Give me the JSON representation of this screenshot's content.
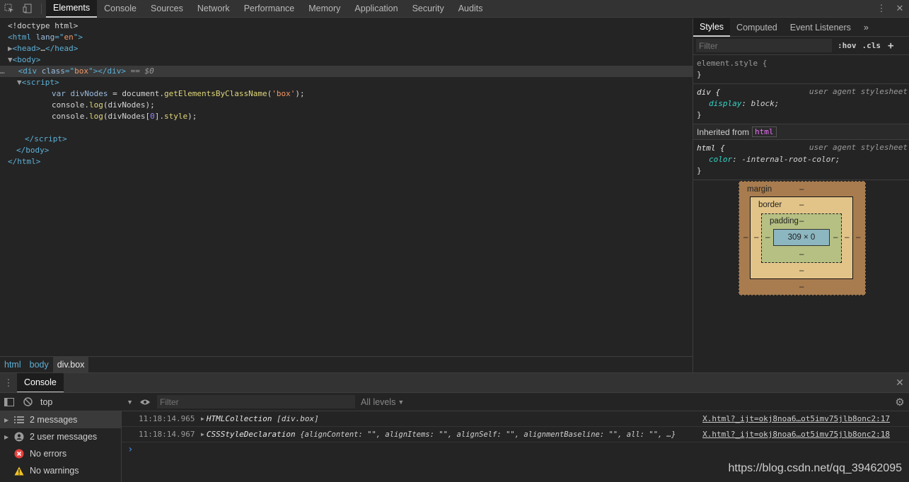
{
  "topbar": {
    "tabs": [
      "Elements",
      "Console",
      "Sources",
      "Network",
      "Performance",
      "Memory",
      "Application",
      "Security",
      "Audits"
    ],
    "active_tab": "Elements",
    "icons": [
      "inspect-icon",
      "device-toolbar-icon",
      "more-vert-icon",
      "close-icon"
    ]
  },
  "elements": {
    "doctype": "<!doctype html>",
    "html_lang": "en",
    "head_collapsed": "…",
    "box_class": "box",
    "eq_marker": "== $0",
    "script_lines": [
      "var divNodes = document.getElementsByClassName('box');",
      "console.log(divNodes);",
      "console.log(divNodes[0].style);"
    ]
  },
  "breadcrumb": [
    "html",
    "body",
    "div.box"
  ],
  "styles": {
    "tabs": [
      "Styles",
      "Computed",
      "Event Listeners"
    ],
    "more": "»",
    "filter_placeholder": "Filter",
    "hov": ":hov",
    "cls": ".cls",
    "add": "+",
    "element_style": "element.style {",
    "close_brace": "}",
    "rule1_selector": "div {",
    "rule1_source": "user agent stylesheet",
    "rule1_prop": "display",
    "rule1_value": "block;",
    "inherited_label": "Inherited from",
    "inherited_tag": "html",
    "rule2_selector": "html {",
    "rule2_source": "user agent stylesheet",
    "rule2_prop": "color",
    "rule2_value": "-internal-root-color;"
  },
  "boxmodel": {
    "margin_label": "margin",
    "border_label": "border",
    "padding_label": "padding",
    "content": "309 × 0",
    "dash": "–"
  },
  "drawer": {
    "tab": "Console",
    "context": "top",
    "filter_placeholder": "Filter",
    "levels": "All levels"
  },
  "console_sidebar": [
    {
      "label": "2 messages",
      "icon": "list-icon"
    },
    {
      "label": "2 user messages",
      "icon": "user-icon"
    },
    {
      "label": "No errors",
      "icon": "error-icon"
    },
    {
      "label": "No warnings",
      "icon": "warning-icon"
    }
  ],
  "console_messages": [
    {
      "time": "11:18:14.965",
      "type": "HTMLCollection",
      "detail": "[div.box]",
      "source": "X.html?_ijt=okj8noa6…ot5imv75jlb8onc2:17"
    },
    {
      "time": "11:18:14.967",
      "type": "CSSStyleDeclaration",
      "detail": "{alignContent: \"\", alignItems: \"\", alignSelf: \"\", alignmentBaseline: \"\", all: \"\", …}",
      "source": "X.html?_ijt=okj8noa6…ot5imv75jlb8onc2:18"
    }
  ],
  "prompt": "›",
  "watermark": "https://blog.csdn.net/qq_39462095",
  "colors": {
    "tag": "#5db0d7",
    "string": "#f29766",
    "prop": "#35d4c7",
    "error": "#e8413e",
    "warning": "#f0c224"
  }
}
